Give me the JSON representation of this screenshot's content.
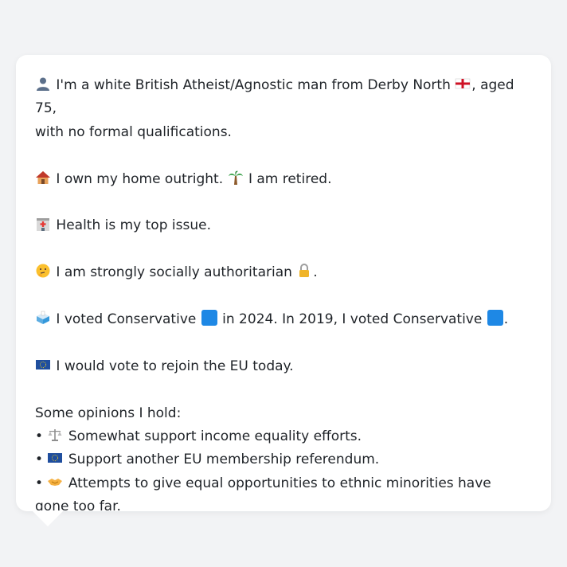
{
  "profile": {
    "line1_part1": "I'm a white British Atheist/Agnostic man from Derby North",
    "line1_part2": ", aged 75,",
    "line1_part3": "with no formal qualifications.",
    "home_text": "I own my home outright.",
    "retired_text": "I am retired.",
    "health_text": "Health is my top issue.",
    "social_text_prefix": "I am strongly socially authoritarian",
    "social_text_suffix": ".",
    "vote_prefix": "I voted Conservative",
    "vote_mid": "in 2024. In 2019, I voted Conservative",
    "vote_suffix": ".",
    "eu_text": "I would vote to rejoin the EU today."
  },
  "opinions": {
    "heading": "Some opinions I hold:",
    "items": [
      {
        "bullet": "•",
        "text": "Somewhat support income equality efforts.",
        "icon": "scales-icon"
      },
      {
        "bullet": "•",
        "text": "Support another EU membership referendum.",
        "icon": "eu-flag-icon"
      },
      {
        "bullet": "•",
        "text": "Attempts to give equal opportunities to ethnic minorities have gone too far.",
        "icon": "handshake-icon"
      }
    ]
  },
  "icons": {
    "person": "person-silhouette-icon",
    "flag": "england-flag-icon",
    "home": "house-icon",
    "palm": "palm-tree-icon",
    "hospital": "hospital-icon",
    "thinking": "thinking-face-icon",
    "lock": "lock-icon",
    "ballot": "ballot-box-icon",
    "eu": "eu-flag-icon",
    "party_color": "#1e88e5"
  }
}
